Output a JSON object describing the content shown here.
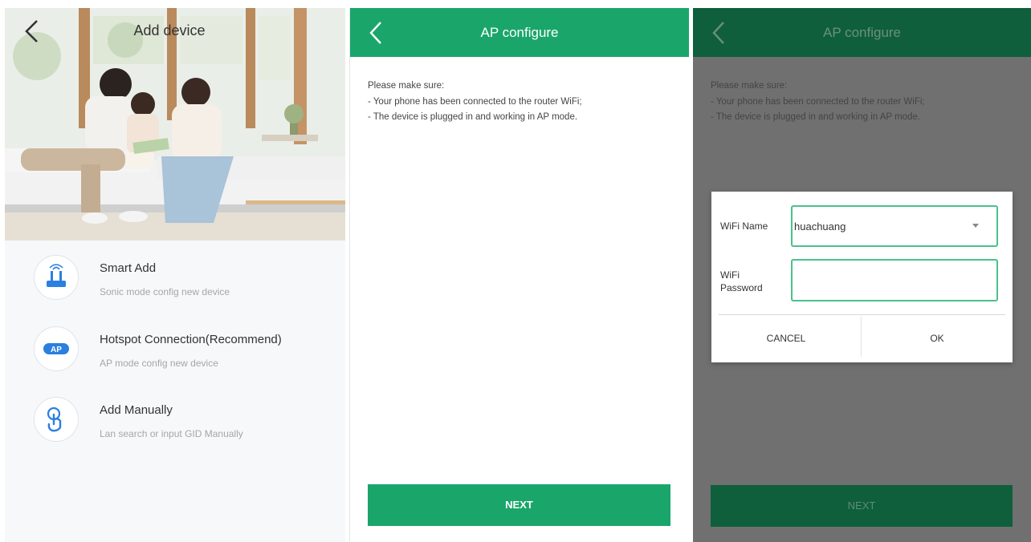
{
  "screen1": {
    "title": "Add device",
    "items": [
      {
        "title": "Smart Add",
        "subtitle": "Sonic mode config new device",
        "icon": "router-icon"
      },
      {
        "title": "Hotspot Connection(Recommend)",
        "subtitle": "AP mode config new device",
        "icon": "ap-badge-icon",
        "badge": "AP"
      },
      {
        "title": "Add Manually",
        "subtitle": "Lan search or input GID Manually",
        "icon": "hand-tap-icon"
      }
    ]
  },
  "screen2": {
    "title": "AP configure",
    "notice": [
      "Please make sure:",
      "- Your phone has been connected to the router WiFi;",
      "- The device is plugged in and working in AP mode."
    ],
    "next_label": "NEXT"
  },
  "screen3": {
    "title": "AP configure",
    "notice": [
      "Please make sure:",
      "- Your phone has been connected to the router WiFi;",
      "- The device is plugged in and working in AP mode."
    ],
    "next_label": "NEXT",
    "dialog": {
      "wifi_name_label": "WiFi Name",
      "wifi_name_value": "huachuang",
      "wifi_password_label_line1": "WiFi",
      "wifi_password_label_line2": "Password",
      "wifi_password_value": "",
      "cancel_label": "CANCEL",
      "ok_label": "OK"
    }
  },
  "colors": {
    "brand_green": "#1aa66a",
    "dim_green": "#0f5f3d",
    "input_border": "#4cc08d",
    "overlay_gray": "#707070",
    "icon_blue": "#2a7fe0"
  }
}
